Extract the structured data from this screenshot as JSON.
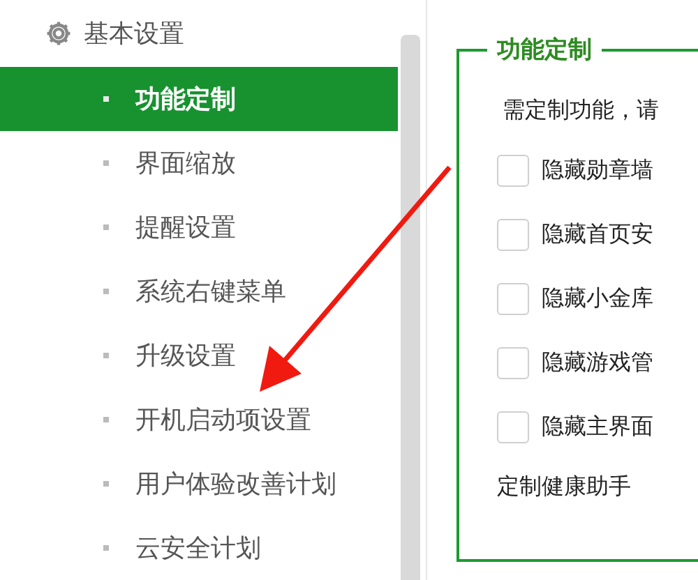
{
  "sidebar": {
    "header": "基本设置",
    "items": [
      {
        "label": "功能定制",
        "selected": true
      },
      {
        "label": "界面缩放",
        "selected": false
      },
      {
        "label": "提醒设置",
        "selected": false
      },
      {
        "label": "系统右键菜单",
        "selected": false
      },
      {
        "label": "升级设置",
        "selected": false
      },
      {
        "label": "开机启动项设置",
        "selected": false
      },
      {
        "label": "用户体验改善计划",
        "selected": false
      },
      {
        "label": "云安全计划",
        "selected": false
      }
    ]
  },
  "panel": {
    "title": "功能定制",
    "intro": "需定制功能，请",
    "options": [
      {
        "label": "隐藏勋章墙",
        "checked": false
      },
      {
        "label": "隐藏首页安",
        "checked": false
      },
      {
        "label": "隐藏小金库",
        "checked": false
      },
      {
        "label": "隐藏游戏管",
        "checked": false
      },
      {
        "label": "隐藏主界面",
        "checked": false
      }
    ],
    "footer": "定制健康助手"
  }
}
